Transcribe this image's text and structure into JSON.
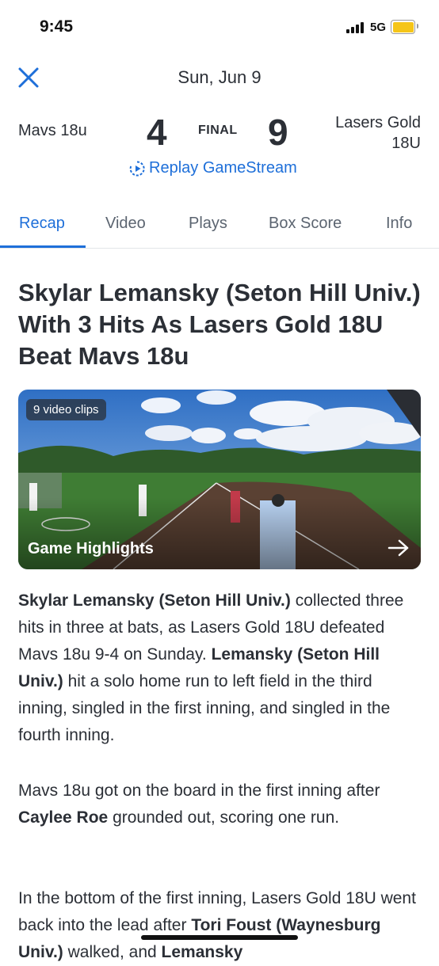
{
  "status_bar": {
    "time": "9:45",
    "network": "5G"
  },
  "header": {
    "date": "Sun, Jun 9"
  },
  "game": {
    "away_team": "Mavs 18u",
    "away_score": "4",
    "status": "FINAL",
    "home_score": "9",
    "home_team_line1": "Lasers Gold",
    "home_team_line2": "18U",
    "replay_label": "Replay GameStream"
  },
  "tabs": [
    {
      "label": "Recap",
      "active": true
    },
    {
      "label": "Video"
    },
    {
      "label": "Plays"
    },
    {
      "label": "Box Score"
    },
    {
      "label": "Info"
    }
  ],
  "article": {
    "headline": "Skylar Lemansky (Seton Hill Univ.) With 3 Hits As Lasers Gold 18U Beat Mavs 18u",
    "video": {
      "badge": "9 video clips",
      "label": "Game Highlights"
    },
    "p1": {
      "b1": "Skylar Lemansky (Seton Hill Univ.)",
      "t1": " collected three hits in three at bats, as Lasers Gold 18U defeated Mavs 18u 9-4 on Sunday. ",
      "b2": "Lemansky (Seton Hill Univ.)",
      "t2": " hit a solo home run to left field in the third inning, singled in the first inning, and singled in the fourth inning."
    },
    "p2": {
      "t1": "Mavs 18u got on the board in the first inning after ",
      "b1": "Caylee Roe",
      "t2": " grounded out, scoring one run."
    },
    "p3": {
      "t1": "In the bottom of the first inning, Lasers Gold 18U went back into the lead after ",
      "b1": "Tori Foust (Waynesburg Univ.)",
      "t2": " walked, and ",
      "b2": "Lemansky"
    }
  },
  "colors": {
    "accent": "#1e6fd9",
    "text": "#2b2f36",
    "battery": "#f5c518"
  },
  "icons": [
    "close-icon",
    "replay-icon",
    "arrow-right-icon",
    "signal-icon",
    "battery-icon"
  ]
}
